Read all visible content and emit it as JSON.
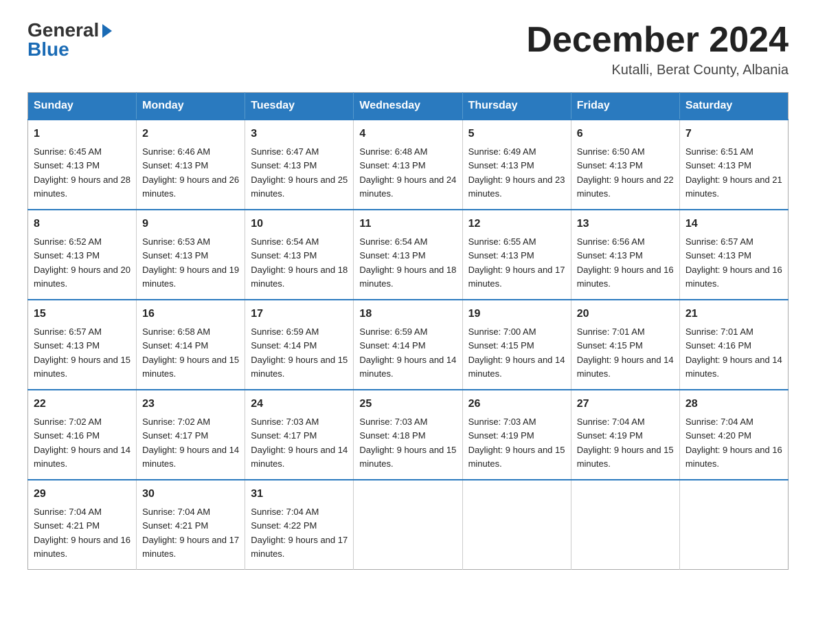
{
  "logo": {
    "general": "General",
    "blue": "Blue"
  },
  "header": {
    "month": "December 2024",
    "location": "Kutalli, Berat County, Albania"
  },
  "weekdays": [
    "Sunday",
    "Monday",
    "Tuesday",
    "Wednesday",
    "Thursday",
    "Friday",
    "Saturday"
  ],
  "weeks": [
    [
      {
        "day": 1,
        "sunrise": "6:45 AM",
        "sunset": "4:13 PM",
        "daylight": "9 hours and 28 minutes."
      },
      {
        "day": 2,
        "sunrise": "6:46 AM",
        "sunset": "4:13 PM",
        "daylight": "9 hours and 26 minutes."
      },
      {
        "day": 3,
        "sunrise": "6:47 AM",
        "sunset": "4:13 PM",
        "daylight": "9 hours and 25 minutes."
      },
      {
        "day": 4,
        "sunrise": "6:48 AM",
        "sunset": "4:13 PM",
        "daylight": "9 hours and 24 minutes."
      },
      {
        "day": 5,
        "sunrise": "6:49 AM",
        "sunset": "4:13 PM",
        "daylight": "9 hours and 23 minutes."
      },
      {
        "day": 6,
        "sunrise": "6:50 AM",
        "sunset": "4:13 PM",
        "daylight": "9 hours and 22 minutes."
      },
      {
        "day": 7,
        "sunrise": "6:51 AM",
        "sunset": "4:13 PM",
        "daylight": "9 hours and 21 minutes."
      }
    ],
    [
      {
        "day": 8,
        "sunrise": "6:52 AM",
        "sunset": "4:13 PM",
        "daylight": "9 hours and 20 minutes."
      },
      {
        "day": 9,
        "sunrise": "6:53 AM",
        "sunset": "4:13 PM",
        "daylight": "9 hours and 19 minutes."
      },
      {
        "day": 10,
        "sunrise": "6:54 AM",
        "sunset": "4:13 PM",
        "daylight": "9 hours and 18 minutes."
      },
      {
        "day": 11,
        "sunrise": "6:54 AM",
        "sunset": "4:13 PM",
        "daylight": "9 hours and 18 minutes."
      },
      {
        "day": 12,
        "sunrise": "6:55 AM",
        "sunset": "4:13 PM",
        "daylight": "9 hours and 17 minutes."
      },
      {
        "day": 13,
        "sunrise": "6:56 AM",
        "sunset": "4:13 PM",
        "daylight": "9 hours and 16 minutes."
      },
      {
        "day": 14,
        "sunrise": "6:57 AM",
        "sunset": "4:13 PM",
        "daylight": "9 hours and 16 minutes."
      }
    ],
    [
      {
        "day": 15,
        "sunrise": "6:57 AM",
        "sunset": "4:13 PM",
        "daylight": "9 hours and 15 minutes."
      },
      {
        "day": 16,
        "sunrise": "6:58 AM",
        "sunset": "4:14 PM",
        "daylight": "9 hours and 15 minutes."
      },
      {
        "day": 17,
        "sunrise": "6:59 AM",
        "sunset": "4:14 PM",
        "daylight": "9 hours and 15 minutes."
      },
      {
        "day": 18,
        "sunrise": "6:59 AM",
        "sunset": "4:14 PM",
        "daylight": "9 hours and 14 minutes."
      },
      {
        "day": 19,
        "sunrise": "7:00 AM",
        "sunset": "4:15 PM",
        "daylight": "9 hours and 14 minutes."
      },
      {
        "day": 20,
        "sunrise": "7:01 AM",
        "sunset": "4:15 PM",
        "daylight": "9 hours and 14 minutes."
      },
      {
        "day": 21,
        "sunrise": "7:01 AM",
        "sunset": "4:16 PM",
        "daylight": "9 hours and 14 minutes."
      }
    ],
    [
      {
        "day": 22,
        "sunrise": "7:02 AM",
        "sunset": "4:16 PM",
        "daylight": "9 hours and 14 minutes."
      },
      {
        "day": 23,
        "sunrise": "7:02 AM",
        "sunset": "4:17 PM",
        "daylight": "9 hours and 14 minutes."
      },
      {
        "day": 24,
        "sunrise": "7:03 AM",
        "sunset": "4:17 PM",
        "daylight": "9 hours and 14 minutes."
      },
      {
        "day": 25,
        "sunrise": "7:03 AM",
        "sunset": "4:18 PM",
        "daylight": "9 hours and 15 minutes."
      },
      {
        "day": 26,
        "sunrise": "7:03 AM",
        "sunset": "4:19 PM",
        "daylight": "9 hours and 15 minutes."
      },
      {
        "day": 27,
        "sunrise": "7:04 AM",
        "sunset": "4:19 PM",
        "daylight": "9 hours and 15 minutes."
      },
      {
        "day": 28,
        "sunrise": "7:04 AM",
        "sunset": "4:20 PM",
        "daylight": "9 hours and 16 minutes."
      }
    ],
    [
      {
        "day": 29,
        "sunrise": "7:04 AM",
        "sunset": "4:21 PM",
        "daylight": "9 hours and 16 minutes."
      },
      {
        "day": 30,
        "sunrise": "7:04 AM",
        "sunset": "4:21 PM",
        "daylight": "9 hours and 17 minutes."
      },
      {
        "day": 31,
        "sunrise": "7:04 AM",
        "sunset": "4:22 PM",
        "daylight": "9 hours and 17 minutes."
      },
      null,
      null,
      null,
      null
    ]
  ]
}
